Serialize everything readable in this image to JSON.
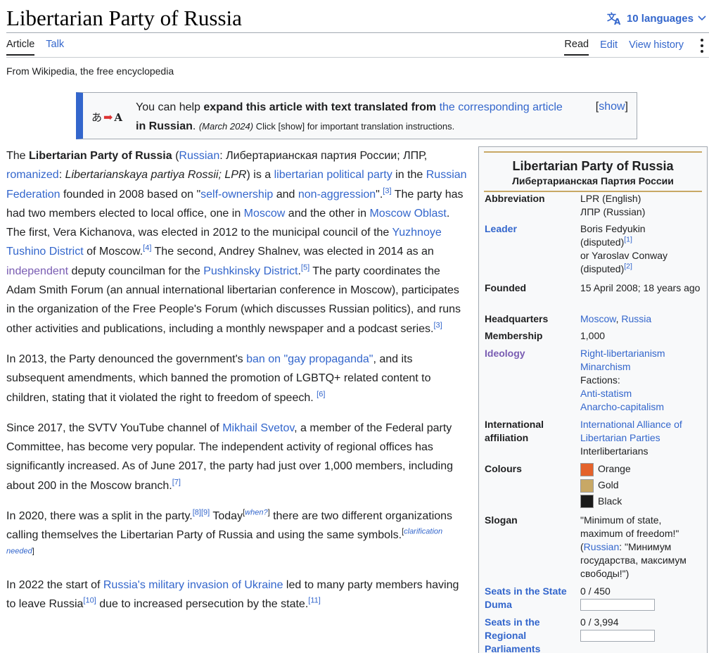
{
  "header": {
    "title": "Libertarian Party of Russia",
    "languages": "10 languages",
    "tabs_left": [
      "Article",
      "Talk"
    ],
    "tabs_right": [
      "Read",
      "Edit",
      "View history"
    ],
    "tagline": "From Wikipedia, the free encyclopedia"
  },
  "notice": {
    "icon_left": "あ",
    "icon_right": "A",
    "t1": "You can help ",
    "t2": "expand this article with text translated from ",
    "t3": "the corresponding article",
    "t4": " in Russian",
    "t5": ".",
    "t6": "(March 2024)",
    "t7": " Click [show] for important translation instructions.",
    "show_open": "[",
    "show": "show",
    "show_close": "]"
  },
  "article": {
    "p1": {
      "a": "The ",
      "b": "Libertarian Party of Russia",
      "c": " (",
      "d": "Russian",
      "e": ": Либертарианская партия России; ЛПР, ",
      "f": "romanized",
      "g": ": ",
      "h": "Libertarianskaya partiya Rossii; LPR",
      "i": ") is a ",
      "j": "libertarian",
      "k": " ",
      "l": "political party",
      "m": " in the ",
      "n": "Russian Federation",
      "o": " founded in 2008 based on \"",
      "p": "self-ownership",
      "q": " and ",
      "r": "non-aggression",
      "s": "\".",
      "t": "[3]",
      "u": " The party has had two members elected to local office, one in ",
      "v": "Moscow",
      "w": " and the other in ",
      "x": "Moscow Oblast",
      "y": ". The first, Vera Kichanova, was elected in 2012 to the municipal council of the ",
      "z": "Yuzhnoye Tushino District",
      "aa": " of Moscow.",
      "ab": "[4]",
      "ac": " The second, Andrey Shalnev, was elected in 2014 as an ",
      "ad": "independent",
      "ae": " deputy councilman for the ",
      "af": "Pushkinsky District",
      "ag": ".",
      "ah": "[5]",
      "ai": " The party coordinates the Adam Smith Forum (an annual international libertarian conference in Moscow), participates in the organization of the Free People's Forum (which discusses Russian politics), and runs other activities and publications, including a monthly newspaper and a podcast series.",
      "aj": "[3]"
    },
    "p2": {
      "a": "In 2013, the Party denounced the government's ",
      "b": "ban on \"gay propaganda\"",
      "c": ", and its subsequent amendments, which banned the promotion of LGBTQ+ related content to children, stating that it violated the right to freedom of speech. ",
      "d": "[6]"
    },
    "p3": {
      "a": "Since 2017, the SVTV YouTube channel of ",
      "b": "Mikhail Svetov",
      "c": ", a member of the Federal party Committee, has become very popular. The independent activity of regional offices has significantly increased. As of June 2017, the party had just over 1,000 members, including about 200 in the Moscow branch.",
      "d": "[7]"
    },
    "p4": {
      "a": "In 2020, there was a split in the party.",
      "b": "[8]",
      "c": "[9]",
      "d": " Today",
      "e": "[",
      "f": "when?",
      "g": "]",
      "h": " there are two different organizations calling themselves the Libertarian Party of Russia and using the same symbols.",
      "i": "[",
      "j": "clarification needed",
      "k": "]"
    },
    "p5": {
      "a": "In 2022 the start of ",
      "b": "Russia's military invasion of Ukraine",
      "c": " led to many party members having to leave Russia",
      "d": "[10]",
      "e": " due to increased persecution by the state.",
      "f": "[11]"
    }
  },
  "infobox": {
    "title": "Libertarian Party of Russia",
    "subtitle": "Либертарианская Партия России",
    "abbreviation_label": "Abbreviation",
    "abbreviation_1": "LPR (English)",
    "abbreviation_2": "ЛПР (Russian)",
    "leader_label": "Leader",
    "leader_1": "Boris Fedyukin",
    "leader_1b": "(disputed)",
    "leader_1_ref": "[1]",
    "leader_2": "or Yaroslav Conway",
    "leader_2b": "(disputed)",
    "leader_2_ref": "[2]",
    "founded_label": "Founded",
    "founded": "15 April 2008; 18 years ago",
    "hq_label": "Headquarters",
    "hq_city": "Moscow",
    "hq_sep": ", ",
    "hq_country": "Russia",
    "membership_label": "Membership",
    "membership": "1,000",
    "ideology_label": "Ideology",
    "ideology_1": "Right-libertarianism",
    "ideology_2": "Minarchism",
    "ideology_factions": "Factions:",
    "ideology_3": "Anti-statism",
    "ideology_4": "Anarcho-capitalism",
    "intl_label": "International affiliation",
    "intl_1": "International Alliance of Libertarian Parties",
    "intl_2": "Interlibertarians",
    "colours_label": "Colours",
    "colours": [
      {
        "name": "Orange",
        "hex": "#e4622b"
      },
      {
        "name": "Gold",
        "hex": "#c8a865"
      },
      {
        "name": "Black",
        "hex": "#1a1a1a"
      }
    ],
    "slogan_label": "Slogan",
    "slogan_1": "\"Minimum of state, maximum of freedom!\"",
    "slogan_2a": "(",
    "slogan_2b": "Russian",
    "slogan_2c": ": \"Минимум государства, максимум свободы!\")",
    "duma_label": "Seats in the State Duma",
    "duma": "0 / 450",
    "duma_fraction": 0,
    "regional_label": "Seats in the Regional Parliaments",
    "regional": "0 / 3,994",
    "regional_fraction": 0
  }
}
